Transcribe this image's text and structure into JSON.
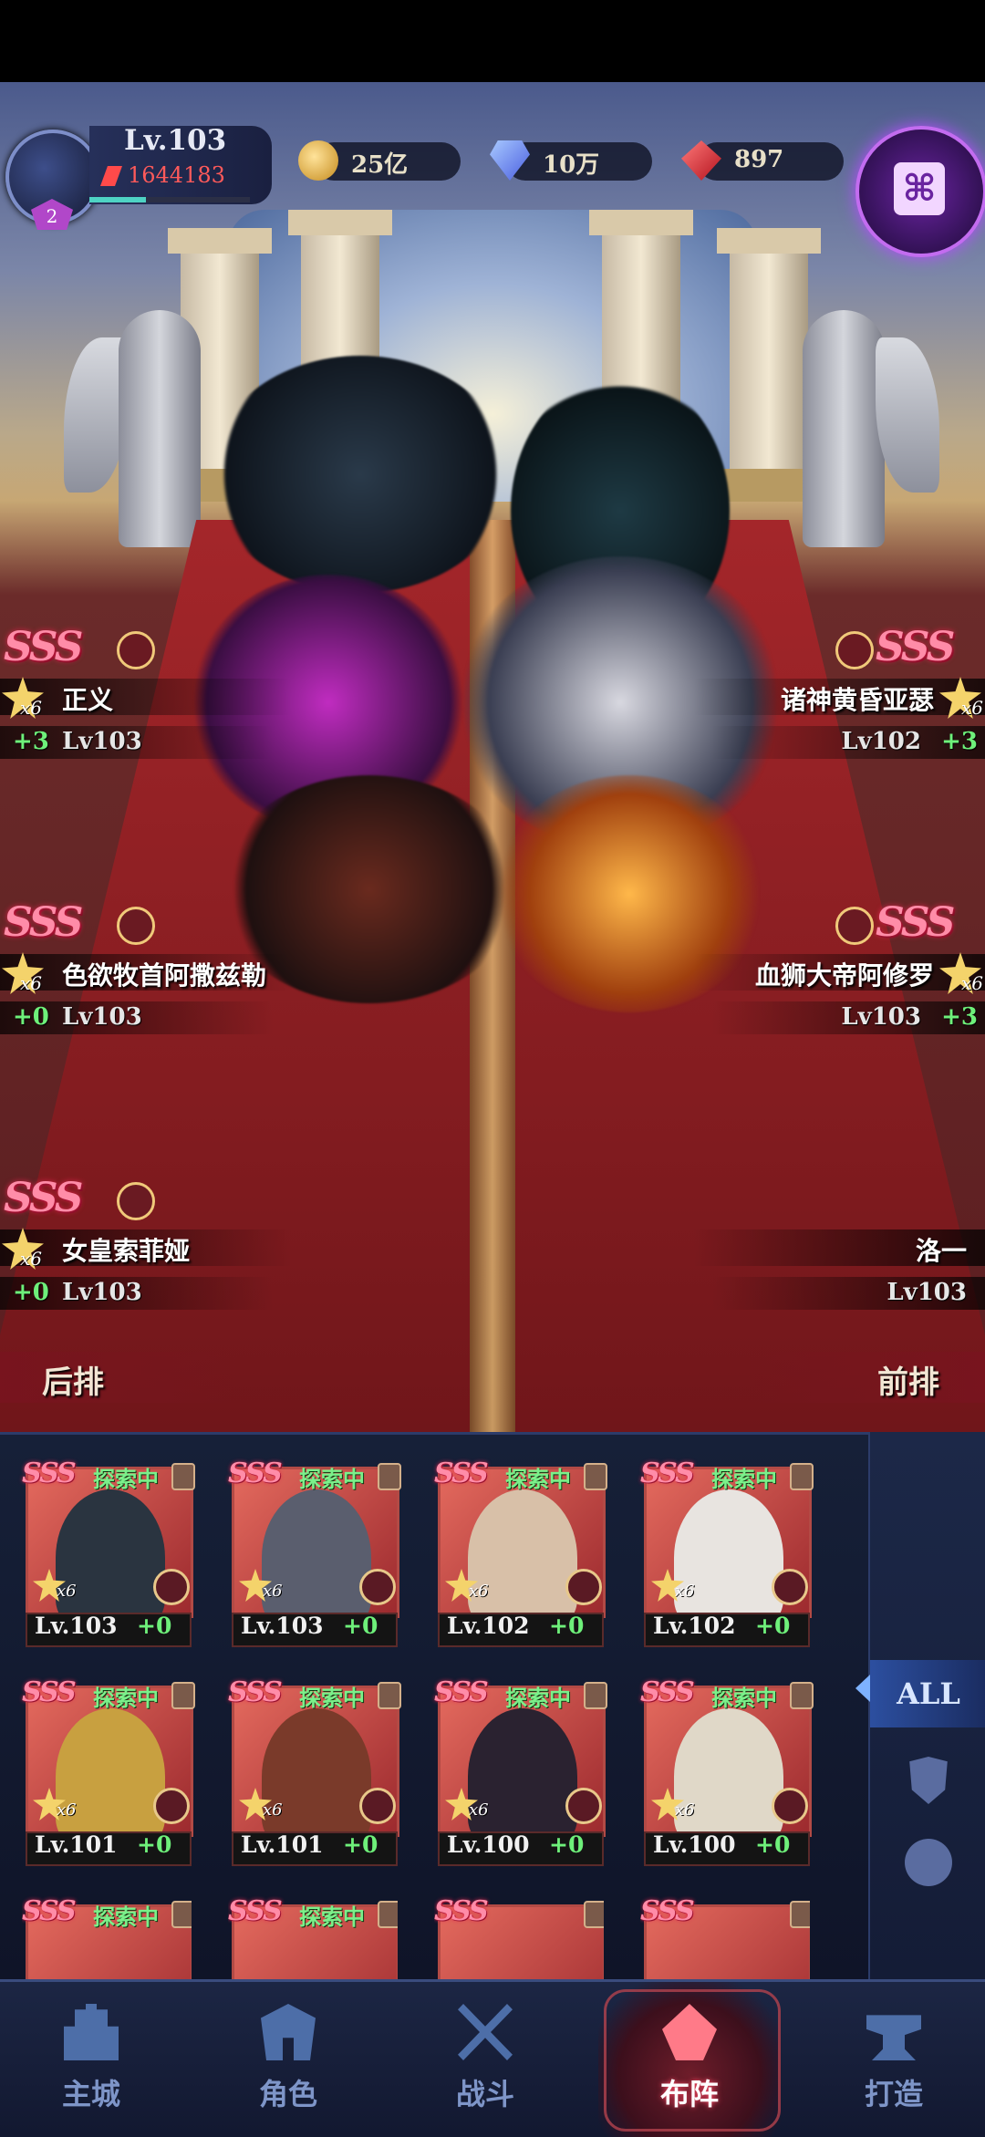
{
  "header": {
    "avatar_badge": "2",
    "level": "Lv.103",
    "power": "1644183",
    "exp_fraction": 0.35,
    "gold": "25亿",
    "diamonds": "10万",
    "rubies": "897",
    "scroll_icon": "scroll-icon"
  },
  "formation": {
    "rank_text": "SSS",
    "stars": "x6",
    "back_row_label": "后排",
    "front_row_label": "前排",
    "left_slots": [
      {
        "name": "正义",
        "plus": "+3",
        "level": "Lv103"
      },
      {
        "name": "色欲牧首阿撒兹勒",
        "plus": "+0",
        "level": "Lv103"
      },
      {
        "name": "女皇索菲娅",
        "plus": "+0",
        "level": "Lv103"
      }
    ],
    "right_slots": [
      {
        "name": "诸神黄昏亚瑟",
        "plus": "+3",
        "level": "Lv102"
      },
      {
        "name": "血狮大帝阿修罗",
        "plus": "+3",
        "level": "Lv103"
      },
      {
        "name": "洛一",
        "plus": "",
        "level": "Lv103"
      }
    ]
  },
  "roster": {
    "status": "探索中",
    "rank": "SSS",
    "stars": "x6",
    "cards": [
      {
        "level": "Lv.103",
        "plus": "+0"
      },
      {
        "level": "Lv.103",
        "plus": "+0"
      },
      {
        "level": "Lv.102",
        "plus": "+0"
      },
      {
        "level": "Lv.102",
        "plus": "+0"
      },
      {
        "level": "Lv.101",
        "plus": "+0"
      },
      {
        "level": "Lv.101",
        "plus": "+0"
      },
      {
        "level": "Lv.100",
        "plus": "+0"
      },
      {
        "level": "Lv.100",
        "plus": "+0"
      }
    ]
  },
  "filter": {
    "all_label": "ALL",
    "icons": [
      "warrior-mask-icon",
      "beast-paw-icon"
    ]
  },
  "nav": {
    "items": [
      {
        "label": "主城",
        "icon": "city-icon"
      },
      {
        "label": "角色",
        "icon": "helmet-icon"
      },
      {
        "label": "战斗",
        "icon": "crossed-swords-icon"
      },
      {
        "label": "布阵",
        "icon": "formation-icon",
        "active": true
      },
      {
        "label": "打造",
        "icon": "anvil-icon"
      }
    ]
  },
  "colors": {
    "accent_purple": "#b54cff",
    "exploring_green": "#7bf08a",
    "plus_green": "#6ef07a",
    "power_red": "#ff5a5a"
  }
}
